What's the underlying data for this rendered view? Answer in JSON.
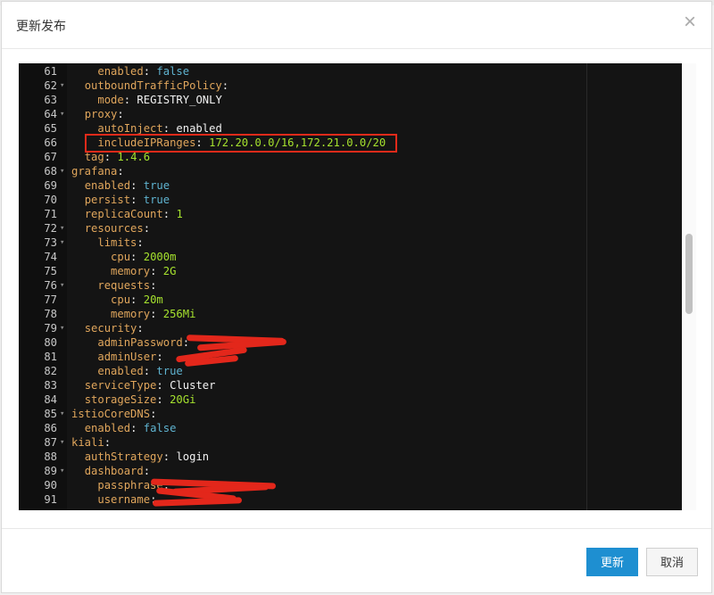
{
  "dialog": {
    "title": "更新发布",
    "close_glyph": "×"
  },
  "editor": {
    "lines": [
      {
        "num": "61",
        "fold": "",
        "indent": 2,
        "key": "enabled",
        "sep": ": ",
        "value": "false",
        "vtype": "bool"
      },
      {
        "num": "62",
        "fold": "▾",
        "indent": 1,
        "key": "outboundTrafficPolicy",
        "sep": ":",
        "value": "",
        "vtype": "none"
      },
      {
        "num": "63",
        "fold": "",
        "indent": 2,
        "key": "mode",
        "sep": ": ",
        "value": "REGISTRY_ONLY",
        "vtype": "str"
      },
      {
        "num": "64",
        "fold": "▾",
        "indent": 1,
        "key": "proxy",
        "sep": ":",
        "value": "",
        "vtype": "none"
      },
      {
        "num": "65",
        "fold": "",
        "indent": 2,
        "key": "autoInject",
        "sep": ": ",
        "value": "enabled",
        "vtype": "str"
      },
      {
        "num": "66",
        "fold": "",
        "indent": 2,
        "key": "includeIPRanges",
        "sep": ": ",
        "value": "172.20.0.0/16,172.21.0.0/20",
        "vtype": "num"
      },
      {
        "num": "67",
        "fold": "",
        "indent": 1,
        "key": "tag",
        "sep": ": ",
        "value": "1.4.6",
        "vtype": "num"
      },
      {
        "num": "68",
        "fold": "▾",
        "indent": 0,
        "key": "grafana",
        "sep": ":",
        "value": "",
        "vtype": "none"
      },
      {
        "num": "69",
        "fold": "",
        "indent": 1,
        "key": "enabled",
        "sep": ": ",
        "value": "true",
        "vtype": "bool"
      },
      {
        "num": "70",
        "fold": "",
        "indent": 1,
        "key": "persist",
        "sep": ": ",
        "value": "true",
        "vtype": "bool"
      },
      {
        "num": "71",
        "fold": "",
        "indent": 1,
        "key": "replicaCount",
        "sep": ": ",
        "value": "1",
        "vtype": "num"
      },
      {
        "num": "72",
        "fold": "▾",
        "indent": 1,
        "key": "resources",
        "sep": ":",
        "value": "",
        "vtype": "none"
      },
      {
        "num": "73",
        "fold": "▾",
        "indent": 2,
        "key": "limits",
        "sep": ":",
        "value": "",
        "vtype": "none"
      },
      {
        "num": "74",
        "fold": "",
        "indent": 3,
        "key": "cpu",
        "sep": ": ",
        "value": "2000m",
        "vtype": "num"
      },
      {
        "num": "75",
        "fold": "",
        "indent": 3,
        "key": "memory",
        "sep": ": ",
        "value": "2G",
        "vtype": "num"
      },
      {
        "num": "76",
        "fold": "▾",
        "indent": 2,
        "key": "requests",
        "sep": ":",
        "value": "",
        "vtype": "none"
      },
      {
        "num": "77",
        "fold": "",
        "indent": 3,
        "key": "cpu",
        "sep": ": ",
        "value": "20m",
        "vtype": "num"
      },
      {
        "num": "78",
        "fold": "",
        "indent": 3,
        "key": "memory",
        "sep": ": ",
        "value": "256Mi",
        "vtype": "num"
      },
      {
        "num": "79",
        "fold": "▾",
        "indent": 1,
        "key": "security",
        "sep": ":",
        "value": "",
        "vtype": "none"
      },
      {
        "num": "80",
        "fold": "",
        "indent": 2,
        "key": "adminPassword",
        "sep": ":",
        "value": "",
        "vtype": "none"
      },
      {
        "num": "81",
        "fold": "",
        "indent": 2,
        "key": "adminUser",
        "sep": ": ",
        "value": "",
        "vtype": "none"
      },
      {
        "num": "82",
        "fold": "",
        "indent": 2,
        "key": "enabled",
        "sep": ": ",
        "value": "true",
        "vtype": "bool"
      },
      {
        "num": "83",
        "fold": "",
        "indent": 1,
        "key": "serviceType",
        "sep": ": ",
        "value": "Cluster",
        "vtype": "str"
      },
      {
        "num": "84",
        "fold": "",
        "indent": 1,
        "key": "storageSize",
        "sep": ": ",
        "value": "20Gi",
        "vtype": "num"
      },
      {
        "num": "85",
        "fold": "▾",
        "indent": 0,
        "key": "istioCoreDNS",
        "sep": ":",
        "value": "",
        "vtype": "none"
      },
      {
        "num": "86",
        "fold": "",
        "indent": 1,
        "key": "enabled",
        "sep": ": ",
        "value": "false",
        "vtype": "bool"
      },
      {
        "num": "87",
        "fold": "▾",
        "indent": 0,
        "key": "kiali",
        "sep": ":",
        "value": "",
        "vtype": "none"
      },
      {
        "num": "88",
        "fold": "",
        "indent": 1,
        "key": "authStrategy",
        "sep": ": ",
        "value": "login",
        "vtype": "str"
      },
      {
        "num": "89",
        "fold": "▾",
        "indent": 1,
        "key": "dashboard",
        "sep": ":",
        "value": "",
        "vtype": "none"
      },
      {
        "num": "90",
        "fold": "",
        "indent": 2,
        "key": "passphrase",
        "sep": ":",
        "value": "",
        "vtype": "none"
      },
      {
        "num": "91",
        "fold": "",
        "indent": 2,
        "key": "username",
        "sep": ": ",
        "value": "",
        "vtype": "none"
      }
    ]
  },
  "footer": {
    "update_label": "更新",
    "cancel_label": "取消"
  },
  "colors": {
    "primary": "#1e8fd1",
    "highlight_border": "#e32a1a",
    "editor_bg": "#141414"
  }
}
